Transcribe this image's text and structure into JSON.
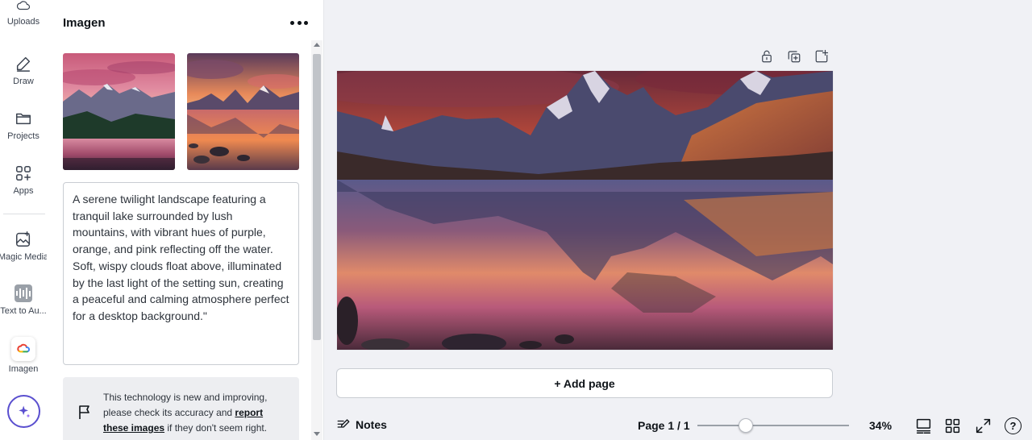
{
  "rail": {
    "items": [
      {
        "label": "Uploads",
        "icon": "cloud-upload-icon"
      },
      {
        "label": "Draw",
        "icon": "pen-icon"
      },
      {
        "label": "Projects",
        "icon": "folder-icon"
      },
      {
        "label": "Apps",
        "icon": "apps-icon"
      },
      {
        "label": "Magic Media",
        "icon": "magic-media-icon"
      },
      {
        "label": "Text to Au...",
        "icon": "audio-wave-icon"
      },
      {
        "label": "Imagen",
        "icon": "imagen-logo-icon"
      }
    ],
    "assistant_icon": "sparkle-icon"
  },
  "panel": {
    "title": "Imagen",
    "more_icon": "more-dots-icon",
    "prompt_text": "A serene twilight landscape featuring a tranquil lake surrounded by lush mountains, with vibrant hues of purple, orange, and pink reflecting off the water. Soft, wispy clouds float above, illuminated by the last light of the setting sun, creating a peaceful and calming atmosphere perfect for a desktop background.\"",
    "notice": {
      "text_before": "This technology is new and improving, please check its accuracy and ",
      "link": "report these images",
      "text_after": " if they don't seem right.",
      "icon": "flag-icon"
    }
  },
  "canvas": {
    "tools": [
      "lock-icon",
      "duplicate-icon",
      "add-icon"
    ],
    "add_page_label": "+ Add page"
  },
  "bottom_bar": {
    "notes_label": "Notes",
    "page_label": "Page 1 / 1",
    "zoom_percent": 34,
    "zoom_label": "34%",
    "zoom_slider_fraction": 0.32
  },
  "colors": {
    "accent": "#5a4fcf",
    "background": "#f0f1f5"
  }
}
